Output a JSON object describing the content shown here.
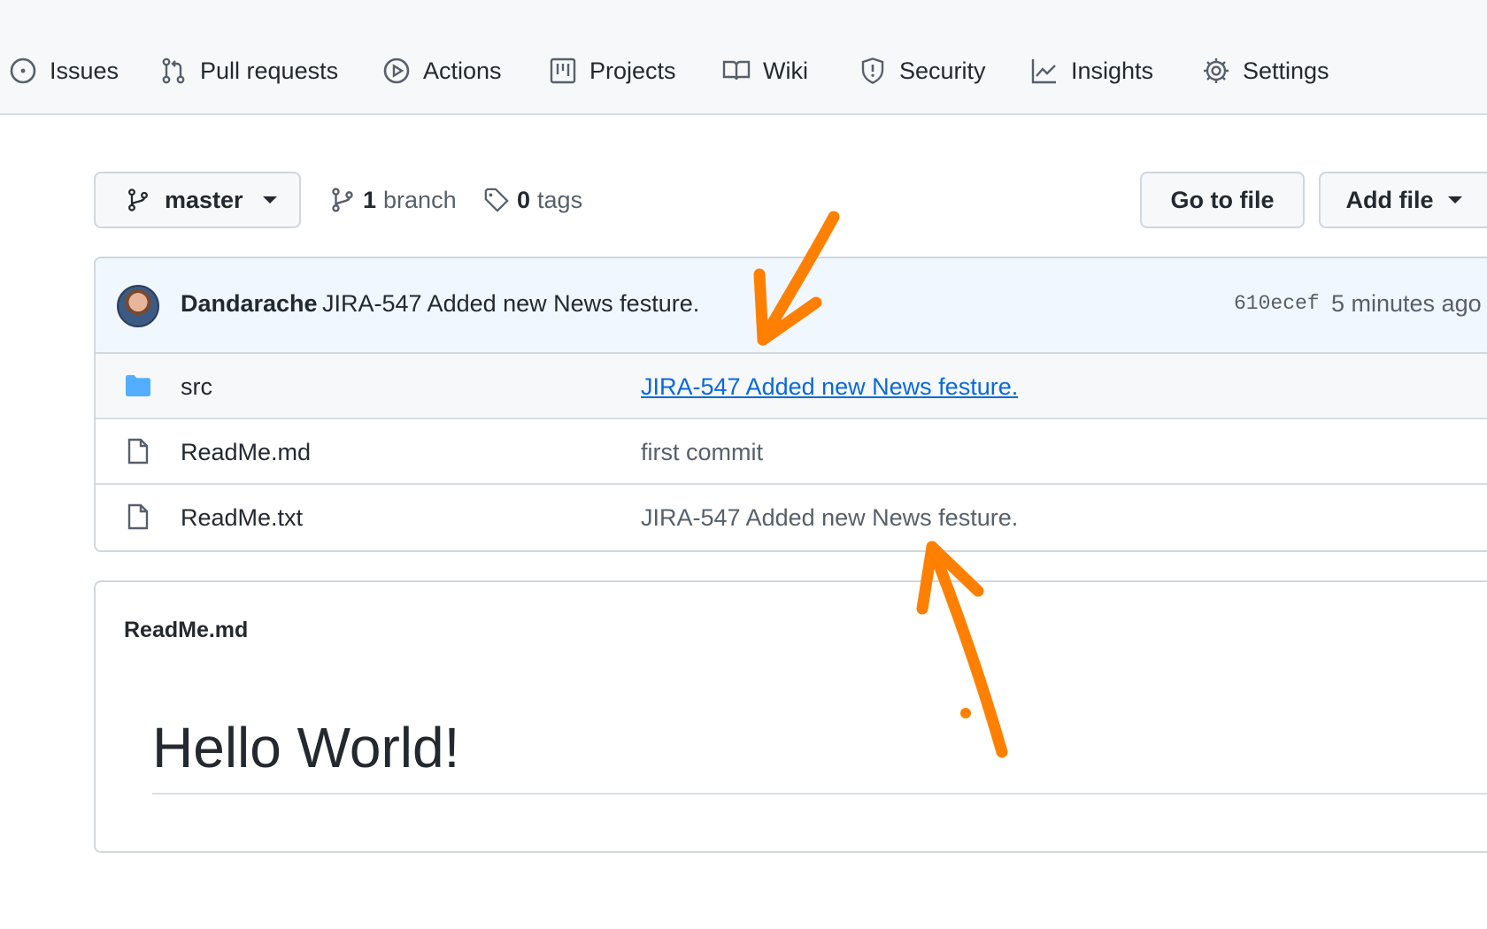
{
  "nav": {
    "items": [
      {
        "label": "Issues",
        "icon": "issue-icon"
      },
      {
        "label": "Pull requests",
        "icon": "pull-request-icon"
      },
      {
        "label": "Actions",
        "icon": "play-icon"
      },
      {
        "label": "Projects",
        "icon": "project-icon"
      },
      {
        "label": "Wiki",
        "icon": "book-icon"
      },
      {
        "label": "Security",
        "icon": "shield-icon"
      },
      {
        "label": "Insights",
        "icon": "graph-icon"
      },
      {
        "label": "Settings",
        "icon": "gear-icon"
      }
    ]
  },
  "branch_bar": {
    "branch_name": "master",
    "branch_count": "1",
    "branch_label": "branch",
    "tag_count": "0",
    "tag_label": "tags",
    "go_to_file": "Go to file",
    "add_file": "Add file"
  },
  "latest_commit": {
    "author": "Dandarache",
    "message": "JIRA-547 Added new News festure.",
    "sha": "610ecef",
    "time": "5 minutes ago"
  },
  "files": [
    {
      "name": "src",
      "type": "folder",
      "commit": "JIRA-547 Added new News festure.",
      "commit_is_link": true
    },
    {
      "name": "ReadMe.md",
      "type": "file",
      "commit": "first commit",
      "commit_is_link": false
    },
    {
      "name": "ReadMe.txt",
      "type": "file",
      "commit": "JIRA-547 Added new News festure.",
      "commit_is_link": false
    }
  ],
  "readme": {
    "filename": "ReadMe.md",
    "heading": "Hello World!"
  },
  "colors": {
    "annotation_arrow": "#ff8000",
    "link": "#0969da",
    "folder": "#54aeff"
  }
}
